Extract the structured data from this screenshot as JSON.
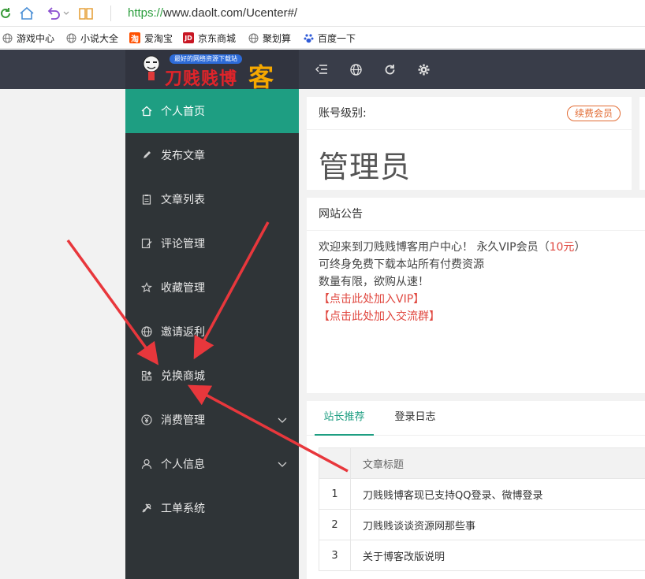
{
  "browser": {
    "url_protocol": "https://",
    "url_rest": "www.daolt.com/Ucenter#/"
  },
  "bookmarks": [
    {
      "label": "游戏中心",
      "icon": "globe-icon"
    },
    {
      "label": "小说大全",
      "icon": "globe-icon"
    },
    {
      "label": "爱淘宝",
      "icon": "taobao-icon"
    },
    {
      "label": "京东商城",
      "icon": "jd-icon"
    },
    {
      "label": "聚划算",
      "icon": "globe-icon"
    },
    {
      "label": "百度一下",
      "icon": "baidu-paw-icon"
    }
  ],
  "header": {
    "logo_tagline": "最好的网络资源下载站",
    "logo_main": "刀贱贱博",
    "logo_suffix": "客",
    "icons": [
      "menu-fold-icon",
      "globe-icon",
      "refresh-icon",
      "settings-gear-icon"
    ]
  },
  "sidebar": {
    "items": [
      {
        "label": "个人首页",
        "icon": "home-icon",
        "active": true
      },
      {
        "label": "发布文章",
        "icon": "pencil-icon"
      },
      {
        "label": "文章列表",
        "icon": "list-doc-icon"
      },
      {
        "label": "评论管理",
        "icon": "comment-edit-icon"
      },
      {
        "label": "收藏管理",
        "icon": "star-icon"
      },
      {
        "label": "邀请返利",
        "icon": "globe-icon"
      },
      {
        "label": "兑换商城",
        "icon": "apps-icon"
      },
      {
        "label": "消费管理",
        "icon": "yen-icon",
        "expandable": true
      },
      {
        "label": "个人信息",
        "icon": "user-icon",
        "expandable": true
      },
      {
        "label": "工单系统",
        "icon": "tools-icon"
      }
    ]
  },
  "account": {
    "level_label": "账号级别:",
    "renew_label": "续费会员",
    "level_value": "管理员"
  },
  "notice": {
    "title": "网站公告",
    "line1_a": "欢迎来到刀贱贱博客用户中心！ 永久VIP会员（",
    "line1_price": "10元",
    "line1_b": "）",
    "line2": "可终身免费下载本站所有付费资源",
    "line3": "数量有限，欲购从速！",
    "link_vip": "【点击此处加入VIP】",
    "link_group": "【点击此处加入交流群】"
  },
  "tabs": {
    "items": [
      "站长推荐",
      "登录日志"
    ],
    "active_index": 0
  },
  "table": {
    "header": "文章标题",
    "rows": [
      {
        "no": "1",
        "title": "刀贱贱博客现已支持QQ登录、微博登录"
      },
      {
        "no": "2",
        "title": "刀贱贱谈谈资源网那些事"
      },
      {
        "no": "3",
        "title": "关于博客改版说明"
      }
    ]
  },
  "colors": {
    "accent": "#1e9e82",
    "sidebar_bg": "#2f3437",
    "header_bg": "#393d49",
    "annotation_arrow": "#e8373c"
  }
}
